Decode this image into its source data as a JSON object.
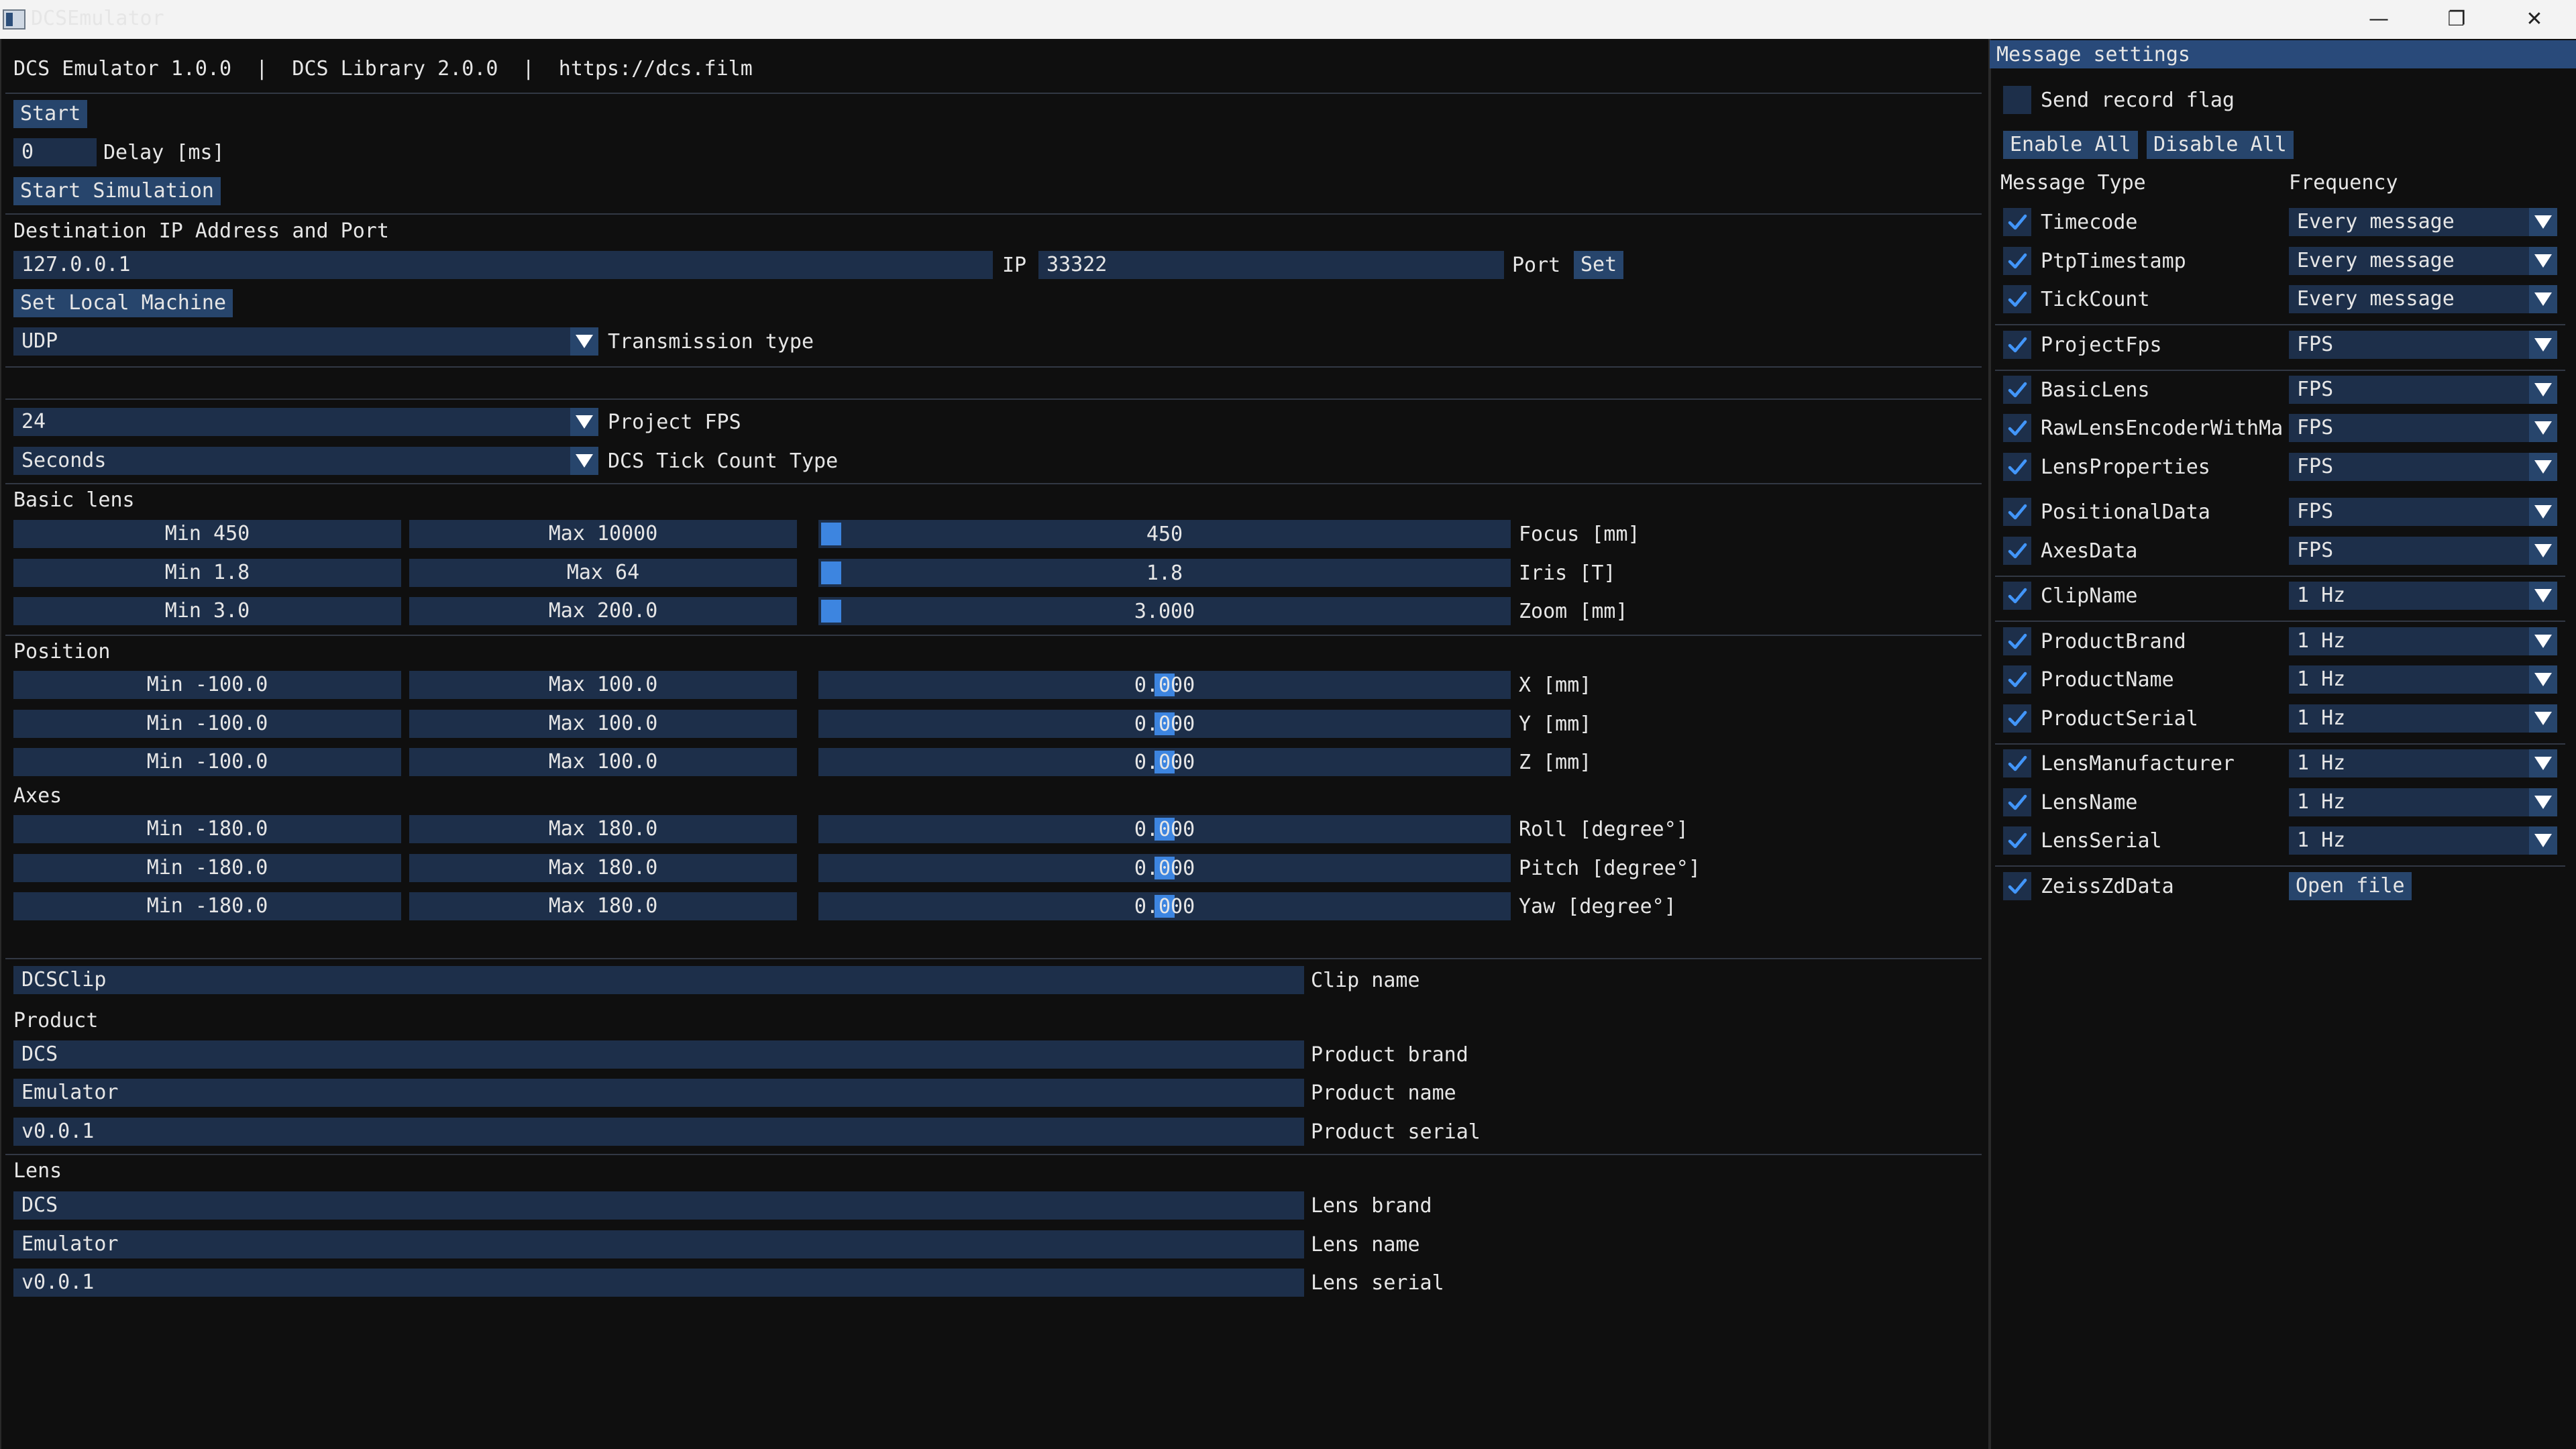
{
  "window": {
    "title": "DCSEmulator",
    "minimize": "—",
    "maximize": "❐",
    "close": "✕"
  },
  "header": {
    "info": "DCS Emulator 1.0.0  |  DCS Library 2.0.0  |  https://dcs.film"
  },
  "controls": {
    "start_label": "Start",
    "delay_value": "0",
    "delay_label": "Delay [ms]",
    "start_simulation_label": "Start Simulation"
  },
  "network": {
    "section_title": "Destination IP Address and Port",
    "ip_value": "127.0.0.1",
    "ip_label": "IP",
    "port_value": "33322",
    "port_label": "Port",
    "set_label": "Set",
    "set_local_label": "Set Local Machine",
    "transmission_value": "UDP",
    "transmission_label": "Transmission type"
  },
  "timing": {
    "fps_value": "24",
    "fps_label": "Project FPS",
    "tick_value": "Seconds",
    "tick_label": "DCS Tick Count Type"
  },
  "basic_lens": {
    "title": "Basic lens",
    "rows": [
      {
        "min": "Min 450",
        "max": "Max 10000",
        "value": "450",
        "label": "Focus [mm]",
        "fraction": 0
      },
      {
        "min": "Min 1.8",
        "max": "Max 64",
        "value": "1.8",
        "label": "Iris [T]",
        "fraction": 0
      },
      {
        "min": "Min 3.0",
        "max": "Max 200.0",
        "value": "3.000",
        "label": "Zoom [mm]",
        "fraction": 0
      }
    ]
  },
  "position": {
    "title": "Position",
    "rows": [
      {
        "min": "Min -100.0",
        "max": "Max 100.0",
        "value": "0.000",
        "label": "X [mm]",
        "fraction": 0.5
      },
      {
        "min": "Min -100.0",
        "max": "Max 100.0",
        "value": "0.000",
        "label": "Y [mm]",
        "fraction": 0.5
      },
      {
        "min": "Min -100.0",
        "max": "Max 100.0",
        "value": "0.000",
        "label": "Z [mm]",
        "fraction": 0.5
      }
    ]
  },
  "axes": {
    "title": "Axes",
    "rows": [
      {
        "min": "Min -180.0",
        "max": "Max 180.0",
        "value": "0.000",
        "label": "Roll [degree°]",
        "fraction": 0.5
      },
      {
        "min": "Min -180.0",
        "max": "Max 180.0",
        "value": "0.000",
        "label": "Pitch [degree°]",
        "fraction": 0.5
      },
      {
        "min": "Min -180.0",
        "max": "Max 180.0",
        "value": "0.000",
        "label": "Yaw [degree°]",
        "fraction": 0.5
      }
    ]
  },
  "clip": {
    "value": "DCSClip",
    "label": "Clip name"
  },
  "product": {
    "title": "Product",
    "brand_value": "DCS",
    "brand_label": "Product brand",
    "name_value": "Emulator",
    "name_label": "Product name",
    "serial_value": "v0.0.1",
    "serial_label": "Product serial"
  },
  "lens": {
    "title": "Lens",
    "brand_value": "DCS",
    "brand_label": "Lens brand",
    "name_value": "Emulator",
    "name_label": "Lens name",
    "serial_value": "v0.0.1",
    "serial_label": "Lens serial"
  },
  "settings": {
    "title": "Message settings",
    "record_flag_label": "Send record flag",
    "record_flag_checked": false,
    "enable_all": "Enable All",
    "disable_all": "Disable All",
    "col_type": "Message Type",
    "col_freq": "Frequency",
    "messages": [
      {
        "name": "Timecode",
        "freq": "Every message",
        "checked": true
      },
      {
        "name": "PtpTimestamp",
        "freq": "Every message",
        "checked": true
      },
      {
        "name": "TickCount",
        "freq": "Every message",
        "checked": true
      },
      {
        "name": "ProjectFps",
        "freq": "FPS",
        "checked": true
      },
      {
        "name": "BasicLens",
        "freq": "FPS",
        "checked": true
      },
      {
        "name": "RawLensEncoderWithMas",
        "freq": "FPS",
        "checked": true
      },
      {
        "name": "LensProperties",
        "freq": "FPS",
        "checked": true
      },
      {
        "name": "PositionalData",
        "freq": "FPS",
        "checked": true
      },
      {
        "name": "AxesData",
        "freq": "FPS",
        "checked": true
      },
      {
        "name": "ClipName",
        "freq": "1 Hz",
        "checked": true
      },
      {
        "name": "ProductBrand",
        "freq": "1 Hz",
        "checked": true
      },
      {
        "name": "ProductName",
        "freq": "1 Hz",
        "checked": true
      },
      {
        "name": "ProductSerial",
        "freq": "1 Hz",
        "checked": true
      },
      {
        "name": "LensManufacturer",
        "freq": "1 Hz",
        "checked": true
      },
      {
        "name": "LensName",
        "freq": "1 Hz",
        "checked": true
      },
      {
        "name": "LensSerial",
        "freq": "1 Hz",
        "checked": true
      },
      {
        "name": "ZeissZdData",
        "freq": "Open file",
        "checked": true
      }
    ]
  },
  "colors": {
    "panel_bg": "#0f0f0f",
    "frame_bg": "#1d2f4a",
    "button": "#27456c",
    "header": "#294a7a",
    "accent": "#3d85e0",
    "check": "#4296fa"
  }
}
